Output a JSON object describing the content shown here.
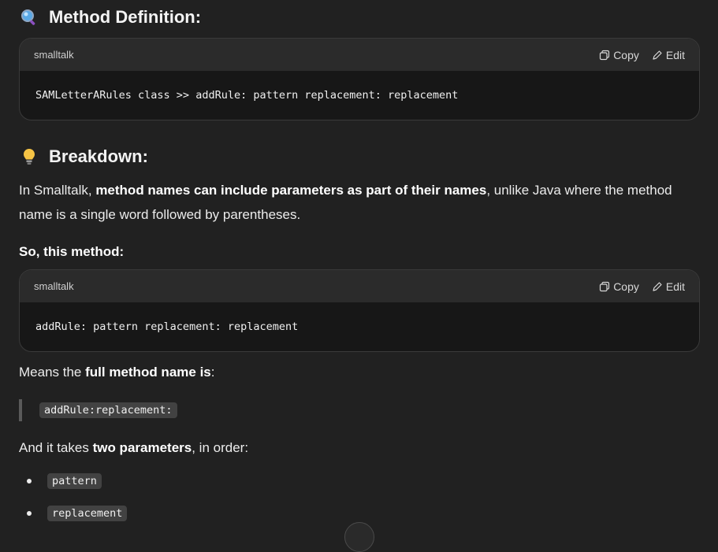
{
  "section1": {
    "emoji": "🔍",
    "title": "Method Definition:"
  },
  "code1": {
    "lang": "smalltalk",
    "copy_label": "Copy",
    "edit_label": "Edit",
    "code": "SAMLetterARules class >> addRule: pattern replacement: replacement"
  },
  "section2": {
    "emoji": "💡",
    "title": "Breakdown:"
  },
  "para1": {
    "t1": "In Smalltalk, ",
    "b1": "method names can include parameters as part of their names",
    "t2": ", unlike Java where the method name is a single word followed by parentheses."
  },
  "para2": {
    "b1": "So, this method:"
  },
  "code2": {
    "lang": "smalltalk",
    "copy_label": "Copy",
    "edit_label": "Edit",
    "code": "addRule: pattern replacement: replacement"
  },
  "para3": {
    "t1": "Means the ",
    "b1": "full method name is",
    "t2": ":"
  },
  "quote": {
    "code": "addRule:replacement:"
  },
  "para4": {
    "t1": "And it takes ",
    "b1": "two parameters",
    "t2": ", in order:"
  },
  "bullets": [
    "pattern",
    "replacement"
  ]
}
